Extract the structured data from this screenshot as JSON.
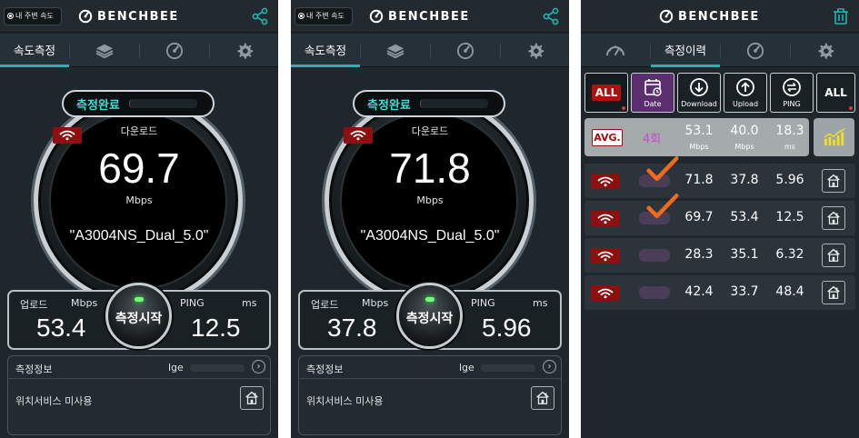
{
  "header": {
    "location_pill": "내 주변 속도",
    "logo_text": "BENCHBEE"
  },
  "tabs": {
    "speed_test": "속도측정",
    "history": "측정이력"
  },
  "screens": [
    {
      "status": "측정완료",
      "download_label": "다운로드",
      "download_value": "69.7",
      "download_unit": "Mbps",
      "ssid": "\"A3004NS_Dual_5.0\"",
      "upload_label": "업로드",
      "upload_unit": "Mbps",
      "upload_value": "53.4",
      "ping_label": "PING",
      "ping_unit": "ms",
      "ping_value": "12.5",
      "start_button": "측정시작",
      "info_title": "측정정보",
      "carrier": "lge",
      "location_status": "위치서비스 미사용"
    },
    {
      "status": "측정완료",
      "download_label": "다운로드",
      "download_value": "71.8",
      "download_unit": "Mbps",
      "ssid": "\"A3004NS_Dual_5.0\"",
      "upload_label": "업로드",
      "upload_unit": "Mbps",
      "upload_value": "37.8",
      "ping_label": "PING",
      "ping_unit": "ms",
      "ping_value": "5.96",
      "start_button": "측정시작",
      "info_title": "측정정보",
      "carrier": "lge",
      "location_status": "위치서비스 미사용"
    }
  ],
  "history": {
    "filters": {
      "network_filter": "ALL",
      "date": "Date",
      "download": "Download",
      "upload": "Upload",
      "ping": "PING",
      "all_right": "ALL"
    },
    "average": {
      "badge": "AVG.",
      "count": "4회",
      "download": "53.1",
      "download_unit": "Mbps",
      "upload": "40.0",
      "upload_unit": "Mbps",
      "ping": "18.3",
      "ping_unit": "ms"
    },
    "rows": [
      {
        "download": "71.8",
        "upload": "37.8",
        "ping": "5.96",
        "checked": true
      },
      {
        "download": "69.7",
        "upload": "53.4",
        "ping": "12.5",
        "checked": true
      },
      {
        "download": "28.3",
        "upload": "35.1",
        "ping": "6.32",
        "checked": false
      },
      {
        "download": "42.4",
        "upload": "33.7",
        "ping": "48.4",
        "checked": false
      }
    ]
  },
  "colors": {
    "accent_teal": "#1fb7b0",
    "wifi_badge_red": "#8c1010",
    "check_orange": "#f26b1d",
    "count_purple": "#c44ad0"
  }
}
